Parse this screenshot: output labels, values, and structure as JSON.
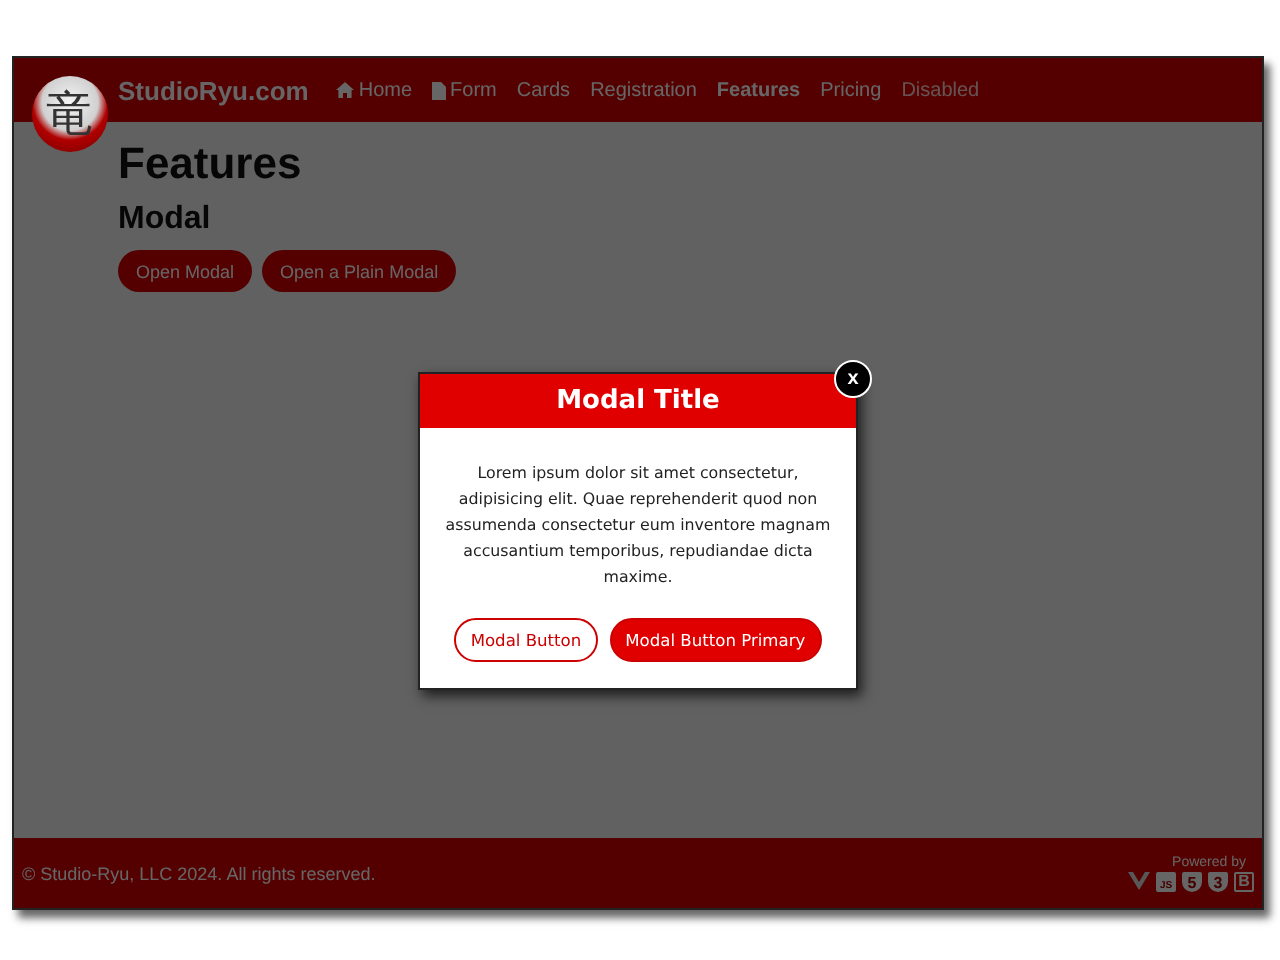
{
  "brand": {
    "logo_glyph": "竜",
    "name": "StudioRyu.com"
  },
  "nav": [
    {
      "label": "Home",
      "selected": false,
      "disabled": false
    },
    {
      "label": "Form",
      "selected": false,
      "disabled": false
    },
    {
      "label": "Cards",
      "selected": false,
      "disabled": false
    },
    {
      "label": "Registration",
      "selected": false,
      "disabled": false
    },
    {
      "label": "Features",
      "selected": true,
      "disabled": false
    },
    {
      "label": "Pricing",
      "selected": false,
      "disabled": false
    },
    {
      "label": "Disabled",
      "selected": false,
      "disabled": true
    }
  ],
  "page": {
    "title": "Features",
    "section": "Modal",
    "buttons": [
      "Open Modal",
      "Open a Plain Modal"
    ]
  },
  "modal": {
    "title": "Modal Title",
    "close": "x",
    "body": "Lorem ipsum dolor sit amet consectetur, adipisicing elit. Quae reprehenderit quod non assumenda consectetur eum inventore magnam accusantium temporibus, repudiandae dicta maxime.",
    "buttons": [
      {
        "label": "Modal Button",
        "kind": "outline"
      },
      {
        "label": "Modal Button Primary",
        "kind": "primary"
      }
    ]
  },
  "footer": {
    "copyright": "© Studio-Ryu, LLC 2024. All rights reserved.",
    "powered_by": "Powered by",
    "badges": [
      {
        "kind": "vue"
      },
      {
        "kind": "square",
        "label": "JS"
      },
      {
        "kind": "shield",
        "label": "5"
      },
      {
        "kind": "shield",
        "label": "3"
      },
      {
        "kind": "box",
        "label": "B"
      }
    ]
  }
}
